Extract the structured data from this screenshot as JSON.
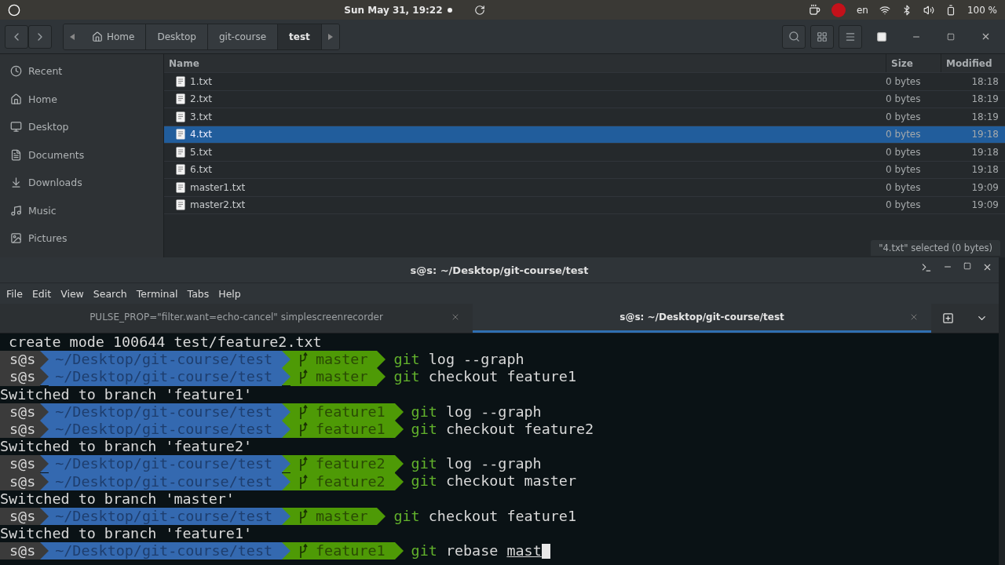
{
  "top_bar": {
    "clock": "Sun May 31, 19:22",
    "language": "en",
    "battery": "100 %"
  },
  "file_manager": {
    "path_bar": [
      {
        "label": "Home",
        "selected": false
      },
      {
        "label": "Desktop",
        "selected": false
      },
      {
        "label": "git-course",
        "selected": false
      },
      {
        "label": "test",
        "selected": true
      }
    ],
    "sidebar": [
      {
        "label": "Recent",
        "kind": "recent"
      },
      {
        "label": "Home",
        "kind": "home"
      },
      {
        "label": "Desktop",
        "kind": "desktop"
      },
      {
        "label": "Documents",
        "kind": "documents"
      },
      {
        "label": "Downloads",
        "kind": "downloads"
      },
      {
        "label": "Music",
        "kind": "music"
      },
      {
        "label": "Pictures",
        "kind": "pictures"
      }
    ],
    "columns": [
      "Name",
      "Size",
      "Modified"
    ],
    "files": [
      {
        "name": "1.txt",
        "size": "0 bytes",
        "modified": "18:18",
        "selected": false
      },
      {
        "name": "2.txt",
        "size": "0 bytes",
        "modified": "18:19",
        "selected": false
      },
      {
        "name": "3.txt",
        "size": "0 bytes",
        "modified": "18:19",
        "selected": false
      },
      {
        "name": "4.txt",
        "size": "0 bytes",
        "modified": "19:18",
        "selected": true
      },
      {
        "name": "5.txt",
        "size": "0 bytes",
        "modified": "19:18",
        "selected": false
      },
      {
        "name": "6.txt",
        "size": "0 bytes",
        "modified": "19:18",
        "selected": false
      },
      {
        "name": "master1.txt",
        "size": "0 bytes",
        "modified": "19:09",
        "selected": false
      },
      {
        "name": "master2.txt",
        "size": "0 bytes",
        "modified": "19:09",
        "selected": false
      }
    ],
    "status": "\"4.txt\" selected  (0 bytes)"
  },
  "terminal": {
    "title": "s@s: ~/Desktop/git-course/test",
    "menu": [
      "File",
      "Edit",
      "View",
      "Search",
      "Terminal",
      "Tabs",
      "Help"
    ],
    "tabs": [
      {
        "label": "PULSE_PROP=\"filter.want=echo-cancel\" simplescreenrecorder",
        "selected": false
      },
      {
        "label": "s@s: ~/Desktop/git-course/test",
        "selected": true
      }
    ],
    "lines": [
      {
        "kind": "output",
        "text": " create mode 100644 test/feature2.txt"
      },
      {
        "kind": "prompt",
        "user": "s@s",
        "path": "~/Desktop/git-course/test",
        "branch": "master",
        "command": "git",
        "args": "log --graph",
        "cursor": false
      },
      {
        "kind": "prompt",
        "user": "s@s",
        "path": "~/Desktop/git-course/test",
        "branch": "master",
        "command": "git",
        "args": "checkout feature1",
        "cursor": false
      },
      {
        "kind": "output",
        "text": "Switched to branch 'feature1'"
      },
      {
        "kind": "prompt",
        "user": "s@s",
        "path": "~/Desktop/git-course/test",
        "branch": "feature1",
        "command": "git",
        "args": "log --graph",
        "cursor": false
      },
      {
        "kind": "prompt",
        "user": "s@s",
        "path": "~/Desktop/git-course/test",
        "branch": "feature1",
        "command": "git",
        "args": "checkout feature2",
        "cursor": false
      },
      {
        "kind": "output",
        "text": "Switched to branch 'feature2'"
      },
      {
        "kind": "prompt",
        "user": "s@s",
        "path": "~/Desktop/git-course/test",
        "branch": "feature2",
        "command": "git",
        "args": "log --graph",
        "cursor": false
      },
      {
        "kind": "prompt",
        "user": "s@s",
        "path": "~/Desktop/git-course/test",
        "branch": "feature2",
        "command": "git",
        "args": "checkout master",
        "cursor": false
      },
      {
        "kind": "output",
        "text": "Switched to branch 'master'"
      },
      {
        "kind": "prompt",
        "user": "s@s",
        "path": "~/Desktop/git-course/test",
        "branch": "master",
        "command": "git",
        "args": "checkout feature1",
        "cursor": false
      },
      {
        "kind": "output",
        "text": "Switched to branch 'feature1'"
      },
      {
        "kind": "prompt",
        "user": "s@s",
        "path": "~/Desktop/git-course/test",
        "branch": "feature1",
        "command": "git",
        "args": "rebase",
        "completion": "mast",
        "cursor": true
      }
    ]
  }
}
